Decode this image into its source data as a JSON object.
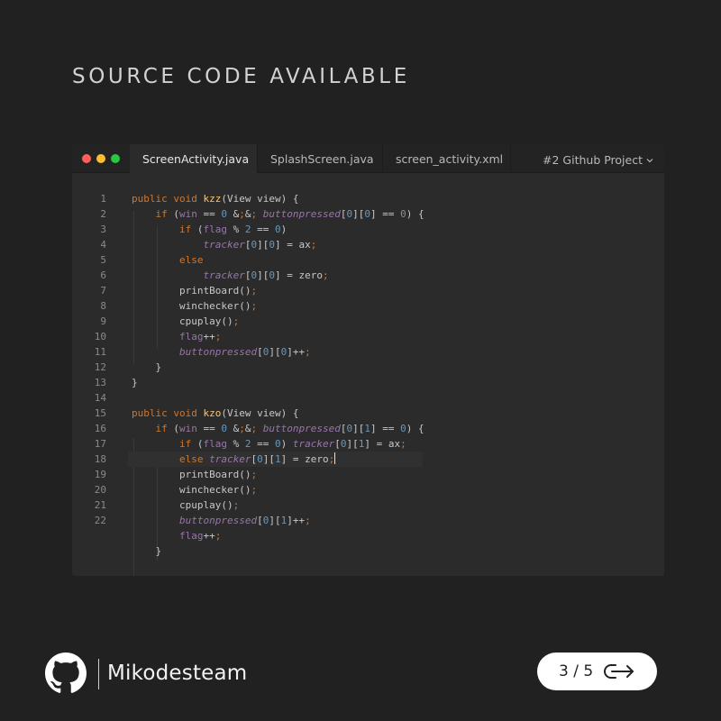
{
  "headline": "SOURCE CODE AVAILABLE",
  "editor": {
    "tabs": [
      {
        "label": "ScreenActivity.java",
        "active": true
      },
      {
        "label": "SplashScreen.java",
        "active": false
      },
      {
        "label": "screen_activity.xml",
        "active": false
      }
    ],
    "project_label": "#2 Github Project",
    "line_numbers": [
      "1",
      "2",
      "3",
      "4",
      "5",
      "6",
      "7",
      "8",
      "9",
      "10",
      "11",
      "12",
      "13",
      "14",
      "15",
      "16",
      "17",
      "18",
      "19",
      "20",
      "21",
      "22"
    ],
    "current_line": 17,
    "code_lines": [
      "public void kzz(View view) {",
      "    if (win == 0 && buttonpressed[0][0] == 0) {",
      "        if (flag % 2 == 0)",
      "            tracker[0][0] = ax;",
      "        else",
      "            tracker[0][0] = zero;",
      "        printBoard();",
      "        winchecker();",
      "        cpuplay();",
      "        flag++;",
      "        buttonpressed[0][0]++;",
      "    }",
      "}",
      "",
      "public void kzo(View view) {",
      "    if (win == 0 && buttonpressed[0][1] == 0) {",
      "        if (flag % 2 == 0) tracker[0][1] = ax;",
      "        else tracker[0][1] = zero;",
      "        printBoard();",
      "        winchecker();",
      "        cpuplay();",
      "        buttonpressed[0][1]++;",
      "        flag++;",
      "    }"
    ]
  },
  "footer": {
    "logo_icon": "github-icon",
    "brand": "Mikodesteam",
    "pager_text": "3 / 5",
    "next_icon": "swipe-next-icon"
  },
  "colors": {
    "background": "#212121",
    "editor_bg": "#2b2b2b",
    "keyword": "#cc7832",
    "function": "#ffc66d",
    "number": "#6897bb",
    "field": "#9876aa"
  }
}
